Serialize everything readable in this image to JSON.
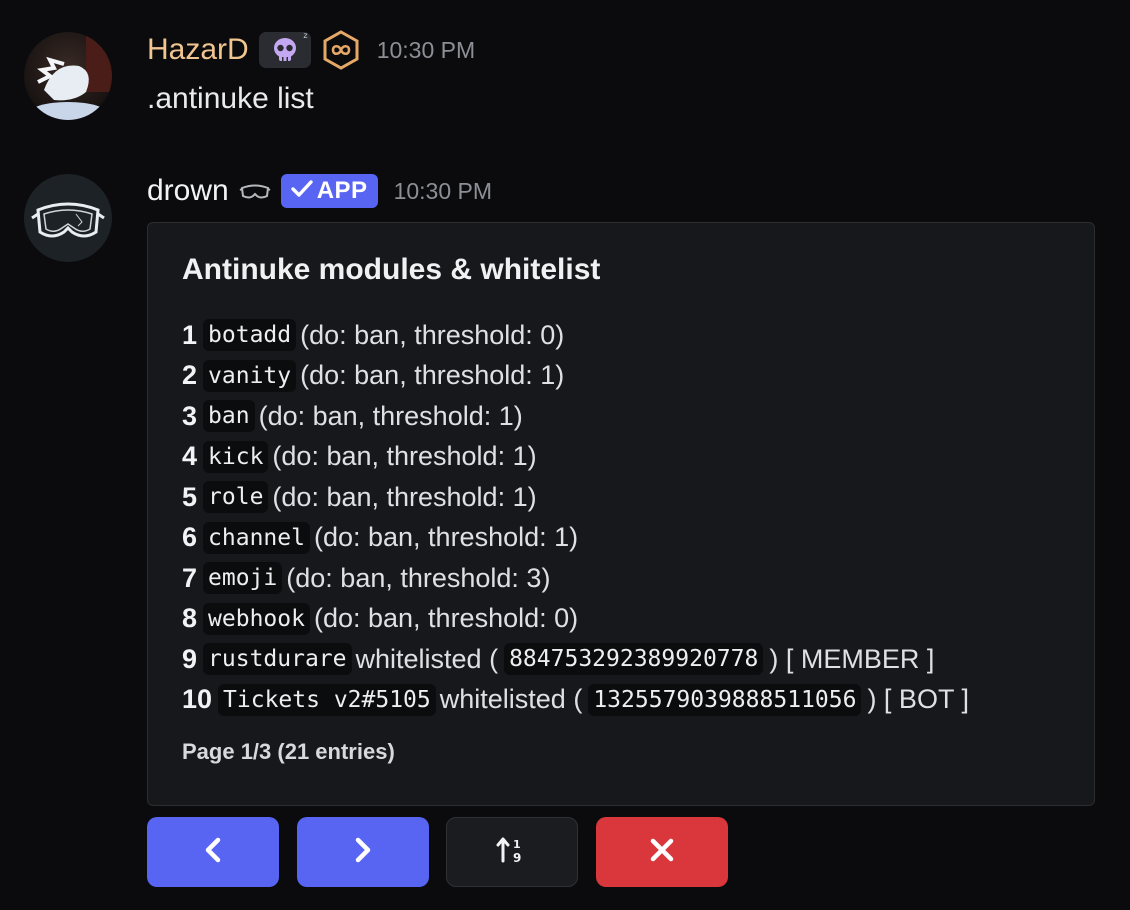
{
  "messages": [
    {
      "author": "HazarD",
      "author_color": "#f1c590",
      "timestamp": "10:30 PM",
      "content": ".antinuke list",
      "badges": [
        "skull-icon",
        "infinity-icon"
      ]
    },
    {
      "author": "drown",
      "author_color": "#f2f3f5",
      "timestamp": "10:30 PM",
      "app_badge": "APP",
      "badges": [
        "goggles-icon",
        "checkmark-icon"
      ]
    }
  ],
  "embed": {
    "title": "Antinuke modules & whitelist",
    "rows": [
      {
        "num": "1",
        "code": "botadd",
        "text": "(do: ban, threshold: 0)"
      },
      {
        "num": "2",
        "code": "vanity",
        "text": "(do: ban, threshold: 1)"
      },
      {
        "num": "3",
        "code": "ban",
        "text": "(do: ban, threshold: 1)"
      },
      {
        "num": "4",
        "code": "kick",
        "text": "(do: ban, threshold: 1)"
      },
      {
        "num": "5",
        "code": "role",
        "text": "(do: ban, threshold: 1)"
      },
      {
        "num": "6",
        "code": "channel",
        "text": "(do: ban, threshold: 1)"
      },
      {
        "num": "7",
        "code": "emoji",
        "text": "(do: ban, threshold: 3)"
      },
      {
        "num": "8",
        "code": "webhook",
        "text": "(do: ban, threshold: 0)"
      }
    ],
    "whitelist": [
      {
        "num": "9",
        "code": "rustdurare",
        "pre": "whitelisted (",
        "id": "884753292389920778",
        "post": ") [ MEMBER ]"
      },
      {
        "num": "10",
        "code": "Tickets v2#5105",
        "pre": "whitelisted (",
        "id": "1325579039888511056",
        "post": ") [ BOT ]"
      }
    ],
    "footer": "Page 1/3 (21 entries)"
  },
  "buttons": [
    {
      "name": "previous-button",
      "icon": "chevron-left-icon",
      "color": "#5865f2"
    },
    {
      "name": "next-button",
      "icon": "chevron-right-icon",
      "color": "#5865f2"
    },
    {
      "name": "sort-button",
      "icon": "sort-numeric-icon",
      "color": "#1b1c1f"
    },
    {
      "name": "close-button",
      "icon": "close-icon",
      "color": "#da373c"
    }
  ]
}
